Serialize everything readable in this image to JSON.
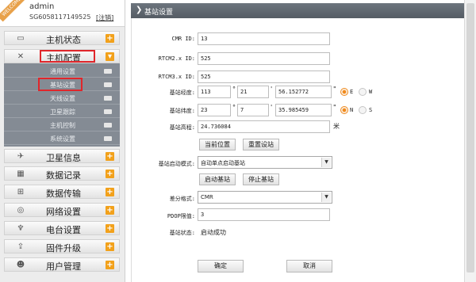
{
  "user": {
    "welcome": "WELCOME",
    "name": "admin",
    "id": "SG6058117149525",
    "logout": "[注销]"
  },
  "nav": {
    "items": [
      {
        "label": "主机状态",
        "icon": "monitor-icon",
        "glyph": "▭",
        "toggle": "+"
      },
      {
        "label": "主机配置",
        "icon": "tools-icon",
        "glyph": "✕",
        "toggle": "▾"
      },
      {
        "label": "卫星信息",
        "icon": "satellite-icon",
        "glyph": "✈",
        "toggle": "+"
      },
      {
        "label": "数据记录",
        "icon": "calendar-icon",
        "glyph": "▦",
        "toggle": "+"
      },
      {
        "label": "数据传输",
        "icon": "network-icon",
        "glyph": "⊞",
        "toggle": "+"
      },
      {
        "label": "网络设置",
        "icon": "globe-icon",
        "glyph": "◎",
        "toggle": "+"
      },
      {
        "label": "电台设置",
        "icon": "radio-tower-icon",
        "glyph": "♆",
        "toggle": "+"
      },
      {
        "label": "固件升级",
        "icon": "upgrade-icon",
        "glyph": "⇪",
        "toggle": "+"
      },
      {
        "label": "用户管理",
        "icon": "user-icon",
        "glyph": "☻",
        "toggle": "+"
      }
    ],
    "subitems": [
      {
        "label": "通用设置"
      },
      {
        "label": "基站设置"
      },
      {
        "label": "天线设置"
      },
      {
        "label": "卫星跟踪"
      },
      {
        "label": "主机控制"
      },
      {
        "label": "系统设置"
      }
    ]
  },
  "page": {
    "title": "基站设置"
  },
  "form": {
    "cmr_label": "CMR ID:",
    "cmr_value": "13",
    "rtcm2_label": "RTCM2.x ID:",
    "rtcm2_value": "525",
    "rtcm3_label": "RTCM3.x ID:",
    "rtcm3_value": "525",
    "lon_label": "基站经度:",
    "lon_deg": "113",
    "lon_deg_mark": "°",
    "lon_min": "21",
    "lon_min_mark": "'",
    "lon_sec": "56.152772",
    "lon_sec_mark": "\"",
    "lon_e": "E",
    "lon_w": "W",
    "lat_label": "基站纬度:",
    "lat_deg": "23",
    "lat_deg_mark": "°",
    "lat_min": "7",
    "lat_min_mark": "'",
    "lat_sec": "35.985459",
    "lat_sec_mark": "\"",
    "lat_n": "N",
    "lat_s": "S",
    "alt_label": "基站高程:",
    "alt_value": "24.736084",
    "alt_unit": "米",
    "btn_current_pos": "当前位置",
    "btn_reset": "重置设站",
    "mode_label": "基站启动模式:",
    "mode_value": "自动单点启动基站",
    "btn_start": "启动基站",
    "btn_stop": "停止基站",
    "diff_label": "差分格式:",
    "diff_value": "CMR",
    "pdop_label": "PDOP限值:",
    "pdop_value": "3",
    "status_label": "基站状态:",
    "status_value": "启动成功",
    "btn_ok": "确定",
    "btn_cancel": "取消"
  },
  "colors": {
    "accent": "#f2a11b",
    "highlight": "#e0262b",
    "submenu_bg": "#848b94"
  }
}
